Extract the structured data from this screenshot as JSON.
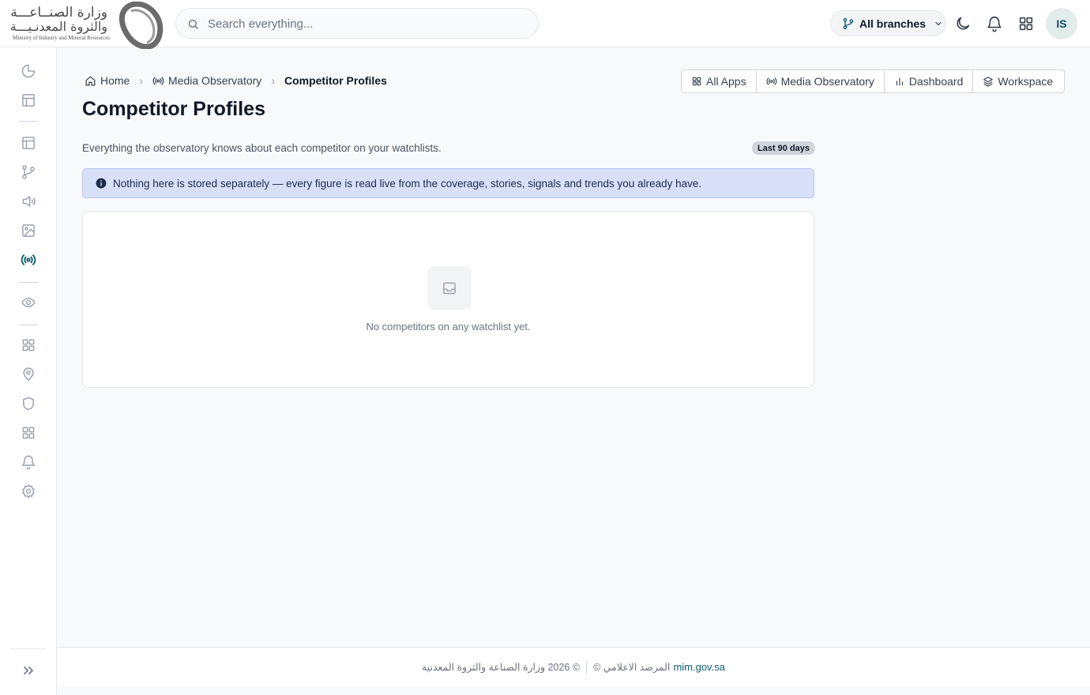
{
  "header": {
    "logo": {
      "arabic_line1": "وزارة الصنــاعـــة",
      "arabic_line2": "والثروة المعدنـيـــة",
      "english": "Ministry of Industry and Mineral Resources"
    },
    "search_placeholder": "Search everything...",
    "branch_selector": "All branches",
    "user_initials": "IS"
  },
  "sidebar": {
    "icons": [
      "pie-chart",
      "layout",
      "layout",
      "git-branch",
      "megaphone",
      "image",
      "radio",
      "eye",
      "grid",
      "map-pin",
      "shield",
      "grid",
      "bell",
      "settings"
    ],
    "active": "radio",
    "expand_icon": "chevrons-right"
  },
  "breadcrumb": {
    "home": "Home",
    "section": "Media Observatory",
    "current": "Competitor Profiles"
  },
  "app_switcher": {
    "all_apps": "All Apps",
    "media_observatory": "Media Observatory",
    "dashboard": "Dashboard",
    "workspace": "Workspace"
  },
  "page": {
    "title": "Competitor Profiles",
    "subtitle": "Everything the observatory knows about each competitor on your watchlists.",
    "range_badge": "Last 90 days",
    "info": "Nothing here is stored separately — every figure is read live from the coverage, stories, signals and trends you already have.",
    "empty_message": "No competitors on any watchlist yet."
  },
  "footer": {
    "copyright": "© 2026 وزارة الصناعة والثروة المعدنية",
    "observatory": "المرصد الاعلامي ©",
    "link": "mim.gov.sa"
  },
  "colors": {
    "accent": "#0f5c6e",
    "info_bg": "#d7e0f7"
  }
}
